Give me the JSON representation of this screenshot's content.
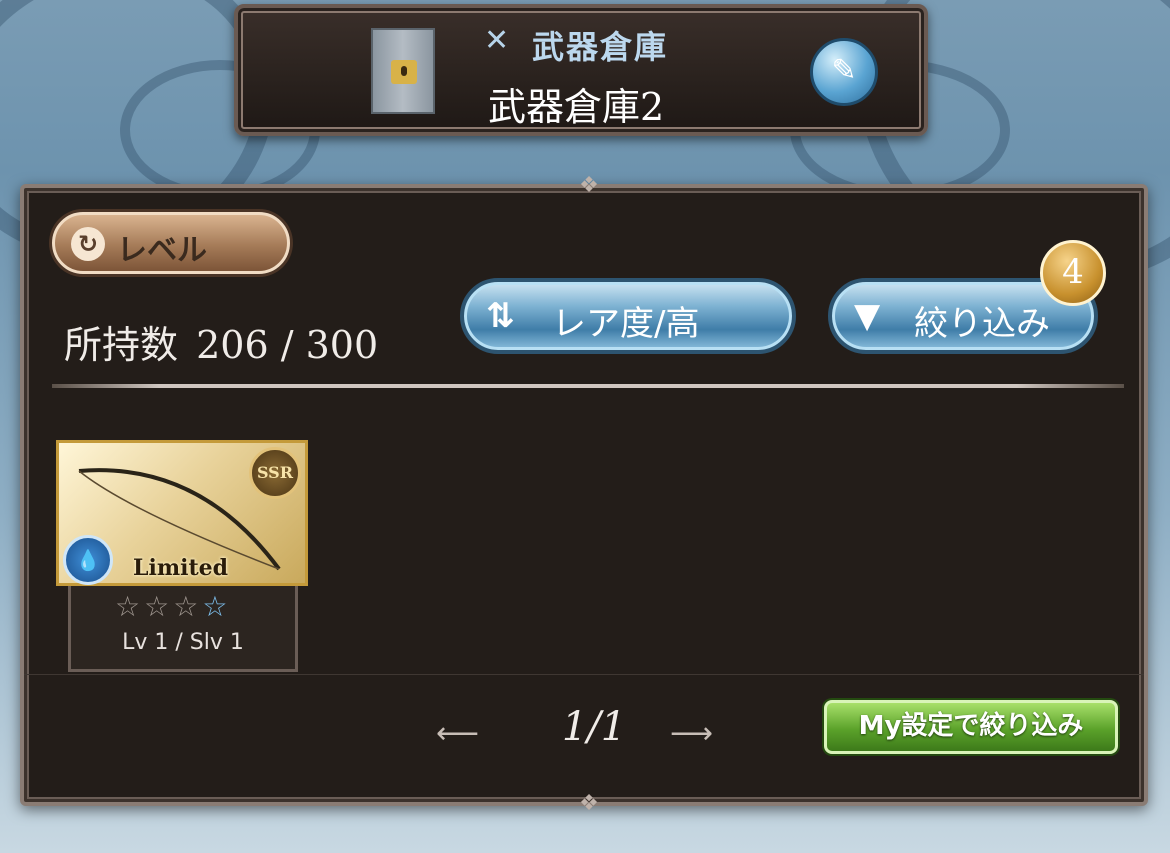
{
  "header": {
    "subtitle_icon": "crossed-swords-icon",
    "subtitle": "武器倉庫",
    "title": "武器倉庫2"
  },
  "toolbar": {
    "level_button": "レベル",
    "owned_label": "所持数",
    "owned_count": "206 / 300",
    "sort_button": "レア度/高",
    "filter_button": "絞り込み",
    "filter_badge": "4"
  },
  "weapons": [
    {
      "rarity": "SSR",
      "tag": "Limited",
      "element": "water",
      "stars_filled": 1,
      "stars_total": 4,
      "level_text": "Lv 1 / Slv 1"
    }
  ],
  "pagination": {
    "page_text": "1/1"
  },
  "my_filter_button": "My設定で絞り込み",
  "colors": {
    "panel_bg": "#231d19",
    "accent_blue": "#7fb3d3",
    "accent_green": "#5ba22a",
    "badge_gold": "#c8912e"
  }
}
